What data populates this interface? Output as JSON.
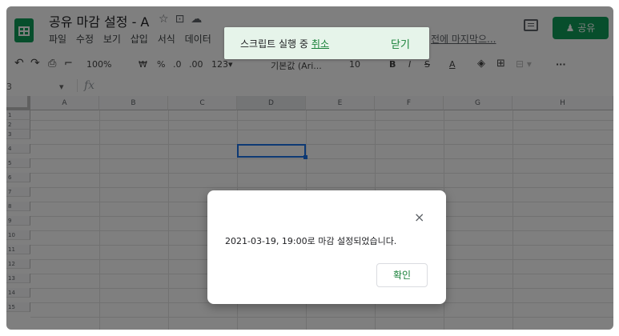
{
  "header": {
    "doc_title": "공유 마감 설정 - A",
    "title_icons": [
      "star-icon",
      "folder-move-icon",
      "cloud-status-icon"
    ],
    "menu": [
      "파일",
      "수정",
      "보기",
      "삽입",
      "서식",
      "데이터"
    ],
    "last_edit": "전에 마지막으...",
    "share_label": "공유",
    "accent_color": "#0f9d58"
  },
  "toolbar": {
    "zoom": "100%",
    "currency": "₩",
    "percent": "%",
    "decimal_decrease": ".0",
    "decimal_increase": ".00",
    "format_more": "123▾",
    "font": "기본값 (Ari...",
    "font_size": "10",
    "bold": "B",
    "italic": "I",
    "strikethrough": "S",
    "text_color": "A",
    "more": "···"
  },
  "formula_bar": {
    "cell_ref": "3",
    "fx": "fx"
  },
  "grid": {
    "columns": [
      "A",
      "B",
      "C",
      "D",
      "E",
      "F",
      "G",
      "H"
    ],
    "rows": [
      "1",
      "2",
      "3",
      "4",
      "5",
      "6",
      "7",
      "8",
      "9",
      "10",
      "11",
      "12",
      "13",
      "14",
      "15"
    ]
  },
  "toast": {
    "message": "스크립트 실행 중",
    "cancel_label": "취소",
    "close_label": "닫기"
  },
  "dialog": {
    "close_icon": "×",
    "message": "2021-03-19, 19:00로 마감 설정되었습니다.",
    "ok_label": "확인"
  }
}
